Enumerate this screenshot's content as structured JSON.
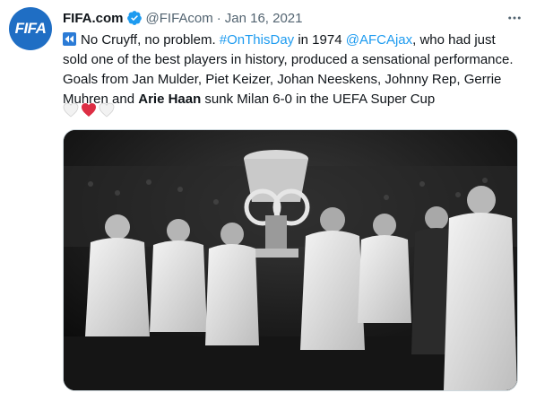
{
  "account": {
    "avatar_text": "FIFA",
    "name": "FIFA.com",
    "handle": "@FIFAcom",
    "separator": "·",
    "date": "Jan 16, 2021"
  },
  "tweet": {
    "seg1": "No Cruyff, no problem. ",
    "hashtag": "#OnThisDay",
    "seg2": " in 1974 ",
    "mention": "@AFCAjax",
    "seg3": ", who had just sold one of the best players in history, produced a sensational performance. Goals from Jan Mulder, Piet Keizer, Johan Neeskens, Johnny Rep, Gerrie Muhren and ",
    "bold": "Arie Haan",
    "seg4": " sunk Milan 6-0 in the UEFA Super Cup"
  },
  "emojis": [
    "white-heart",
    "red-heart",
    "white-heart"
  ],
  "colors": {
    "accent": "#1d9bf0",
    "avatar_bg": "#1f6ec4",
    "heart_red": "#dd2e44"
  },
  "icons": {
    "verified": "verified-badge-icon",
    "more": "more-dots-icon",
    "rewind": "rewind-emoji-icon"
  },
  "media": {
    "type": "black-and-white photo",
    "subject": "Ajax players in white robes lifting the trophy"
  }
}
